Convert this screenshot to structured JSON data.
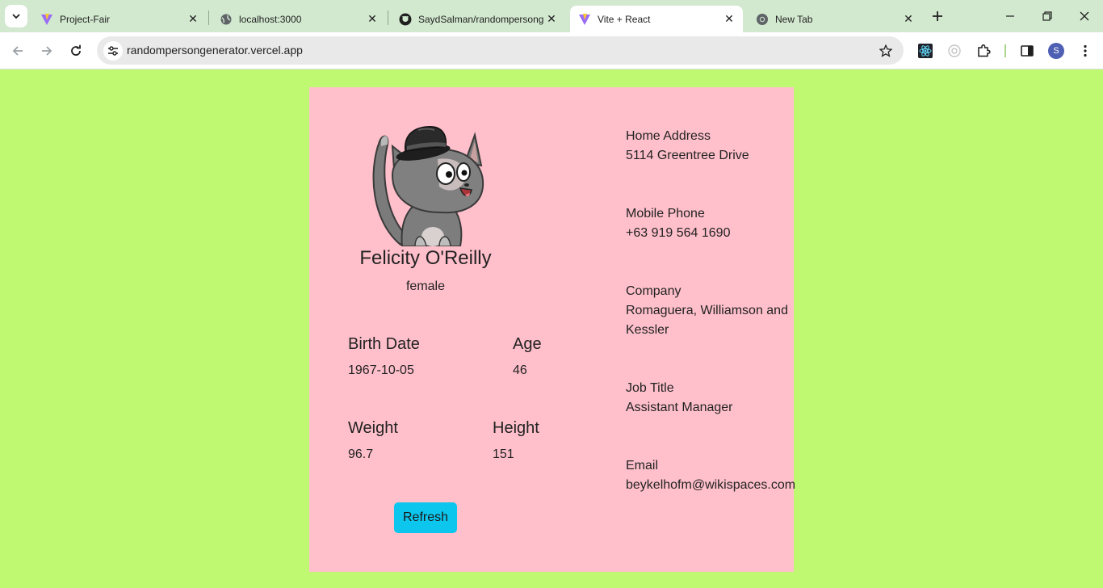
{
  "browser": {
    "tabs": [
      {
        "title": "Project-Fair",
        "icon": "vite-icon",
        "active": false
      },
      {
        "title": "localhost:3000",
        "icon": "globe-icon",
        "active": false
      },
      {
        "title": "SaydSalman/randompersong",
        "icon": "github-icon",
        "active": false
      },
      {
        "title": "Vite + React",
        "icon": "vite-icon",
        "active": true
      },
      {
        "title": "New Tab",
        "icon": "chrome-icon",
        "active": false
      }
    ],
    "url": "randompersongenerator.vercel.app",
    "profile_initial": "S"
  },
  "profile": {
    "name": "Felicity O'Reilly",
    "gender": "female"
  },
  "stats": {
    "birth_date_label": "Birth Date",
    "birth_date": "1967-10-05",
    "age_label": "Age",
    "age": "46",
    "weight_label": "Weight",
    "weight": "96.7",
    "height_label": "Height",
    "height": "151"
  },
  "details": {
    "address_label": "Home Address",
    "address": "5114 Greentree Drive",
    "phone_label": "Mobile Phone",
    "phone": "+63 919 564 1690",
    "company_label": "Company",
    "company_line1": "Romaguera, Williamson and",
    "company_line2": "Kessler",
    "job_label": "Job Title",
    "job": "Assistant Manager",
    "email_label": "Email",
    "email": "beykelhofm@wikispaces.com"
  },
  "actions": {
    "refresh_label": "Refresh"
  },
  "colors": {
    "page_bg": "#bff972",
    "card_bg": "#ffc0cb",
    "button_bg": "#0dc6ee"
  }
}
